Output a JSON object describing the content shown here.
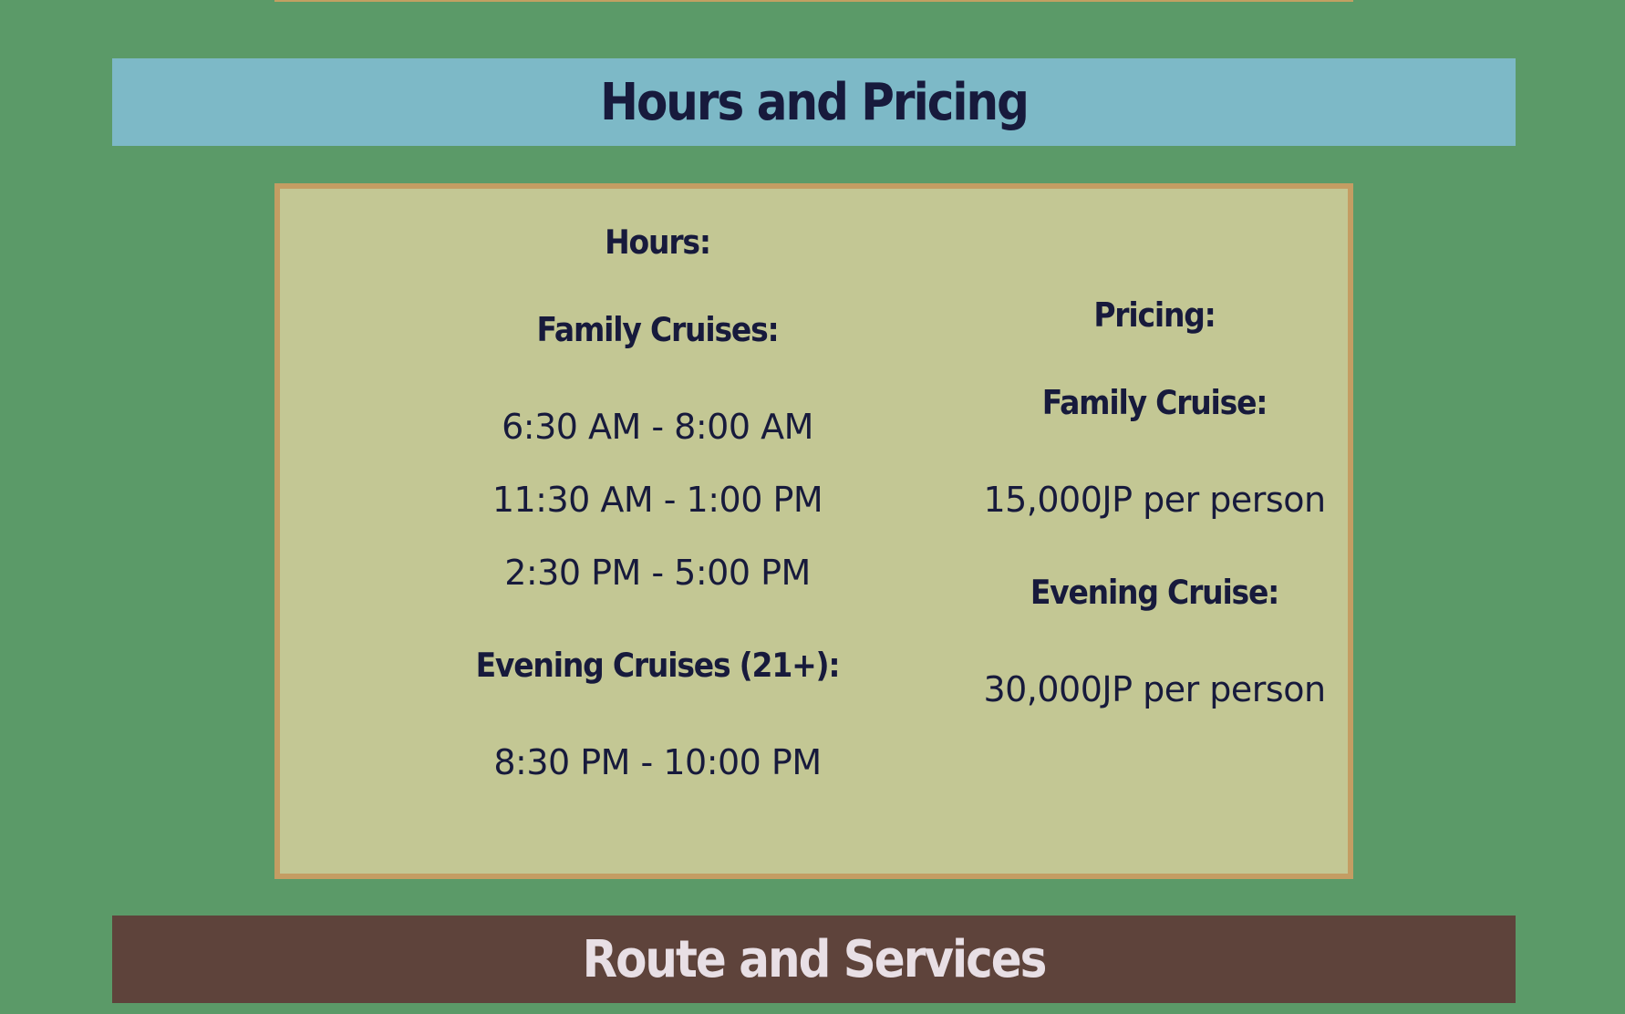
{
  "sections": {
    "hours_and_pricing_title": "Hours and Pricing",
    "route_and_services_title": "Route and Services"
  },
  "hours": {
    "heading": "Hours:",
    "family": {
      "heading": "Family Cruises:",
      "times": [
        "6:30 AM - 8:00 AM",
        "11:30 AM - 1:00 PM",
        "2:30 PM - 5:00 PM"
      ]
    },
    "evening": {
      "heading": "Evening Cruises (21+):",
      "times": [
        "8:30 PM - 10:00 PM"
      ]
    }
  },
  "pricing": {
    "heading": "Pricing:",
    "family": {
      "heading": "Family Cruise:",
      "price": "15,000JP per person"
    },
    "evening": {
      "heading": "Evening Cruise:",
      "price": "30,000JP per person"
    }
  },
  "colors": {
    "page_background": "#5b9a68",
    "hours_banner": "#7db9c7",
    "route_banner": "#5e433b",
    "card_background": "#c3c794",
    "card_border": "#c49d63",
    "text_dark": "#171a3c",
    "text_light": "#e8dfe5"
  }
}
